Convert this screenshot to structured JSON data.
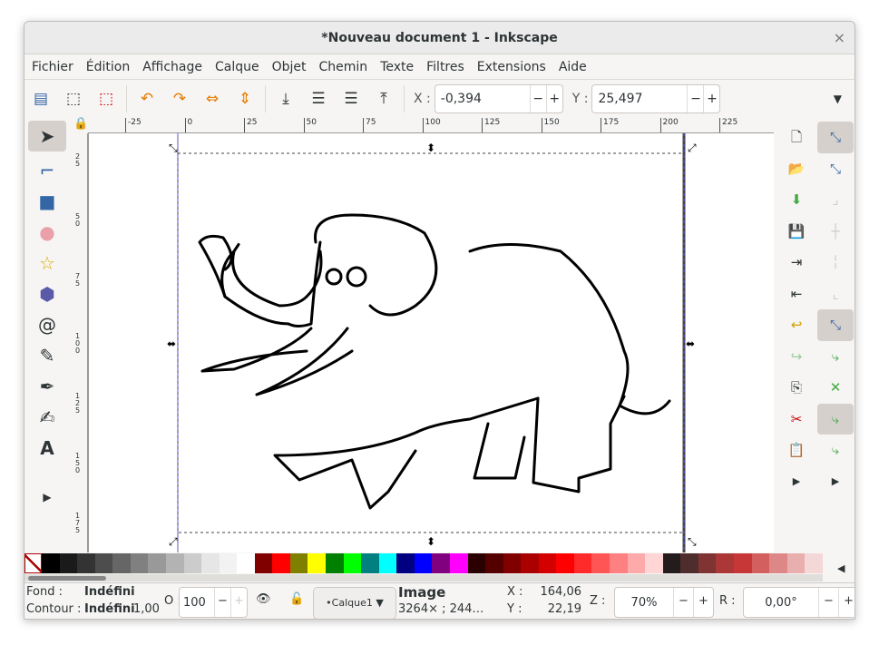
{
  "window": {
    "title": "*Nouveau document 1 - Inkscape",
    "close": "×"
  },
  "menu": [
    "Fichier",
    "Édition",
    "Affichage",
    "Calque",
    "Objet",
    "Chemin",
    "Texte",
    "Filtres",
    "Extensions",
    "Aide"
  ],
  "toolbar": {
    "x_label": "X :",
    "x_value": "-0,394",
    "y_label": "Y :",
    "y_value": "25,497",
    "minus": "−",
    "plus": "+"
  },
  "ruler": {
    "h_ticks": [
      "-25",
      "0",
      "25",
      "50",
      "75",
      "100",
      "125",
      "150",
      "175",
      "200",
      "225"
    ],
    "v_ticks": [
      "25",
      "50",
      "75",
      "100",
      "125",
      "150",
      "175"
    ]
  },
  "palette": [
    "#000000",
    "#1a1a1a",
    "#333333",
    "#4d4d4d",
    "#666666",
    "#808080",
    "#999999",
    "#b3b3b3",
    "#cccccc",
    "#e6e6e6",
    "#f2f2f2",
    "#ffffff",
    "#800000",
    "#ff0000",
    "#808000",
    "#ffff00",
    "#008000",
    "#00ff00",
    "#008080",
    "#00ffff",
    "#000080",
    "#0000ff",
    "#800080",
    "#ff00ff",
    "#2b0000",
    "#550000",
    "#800000",
    "#aa0000",
    "#d40000",
    "#ff0000",
    "#ff2a2a",
    "#ff5555",
    "#ff8080",
    "#ffaaaa",
    "#ffd5d5",
    "#241c1c",
    "#502d2d",
    "#803333",
    "#ab3737",
    "#c83737",
    "#d35f5f",
    "#de8787",
    "#e9afaf",
    "#f4d7d7"
  ],
  "status": {
    "fill_label": "Fond :",
    "fill_value": "Indéfini",
    "stroke_label": "Contour :",
    "stroke_value": "Indéfini",
    "stroke_width": "1,00",
    "opacity_label": "O :",
    "opacity_value": "100",
    "layer": "•Calque1",
    "object_type": "Image",
    "object_size": "3264×  ; 244…",
    "cursor_x_label": "X :",
    "cursor_x": "164,06",
    "cursor_y_label": "Y :",
    "cursor_y": "22,19",
    "zoom_label": "Z :",
    "zoom": "70%",
    "rotate_label": "R :",
    "rotate": "0,00°"
  }
}
